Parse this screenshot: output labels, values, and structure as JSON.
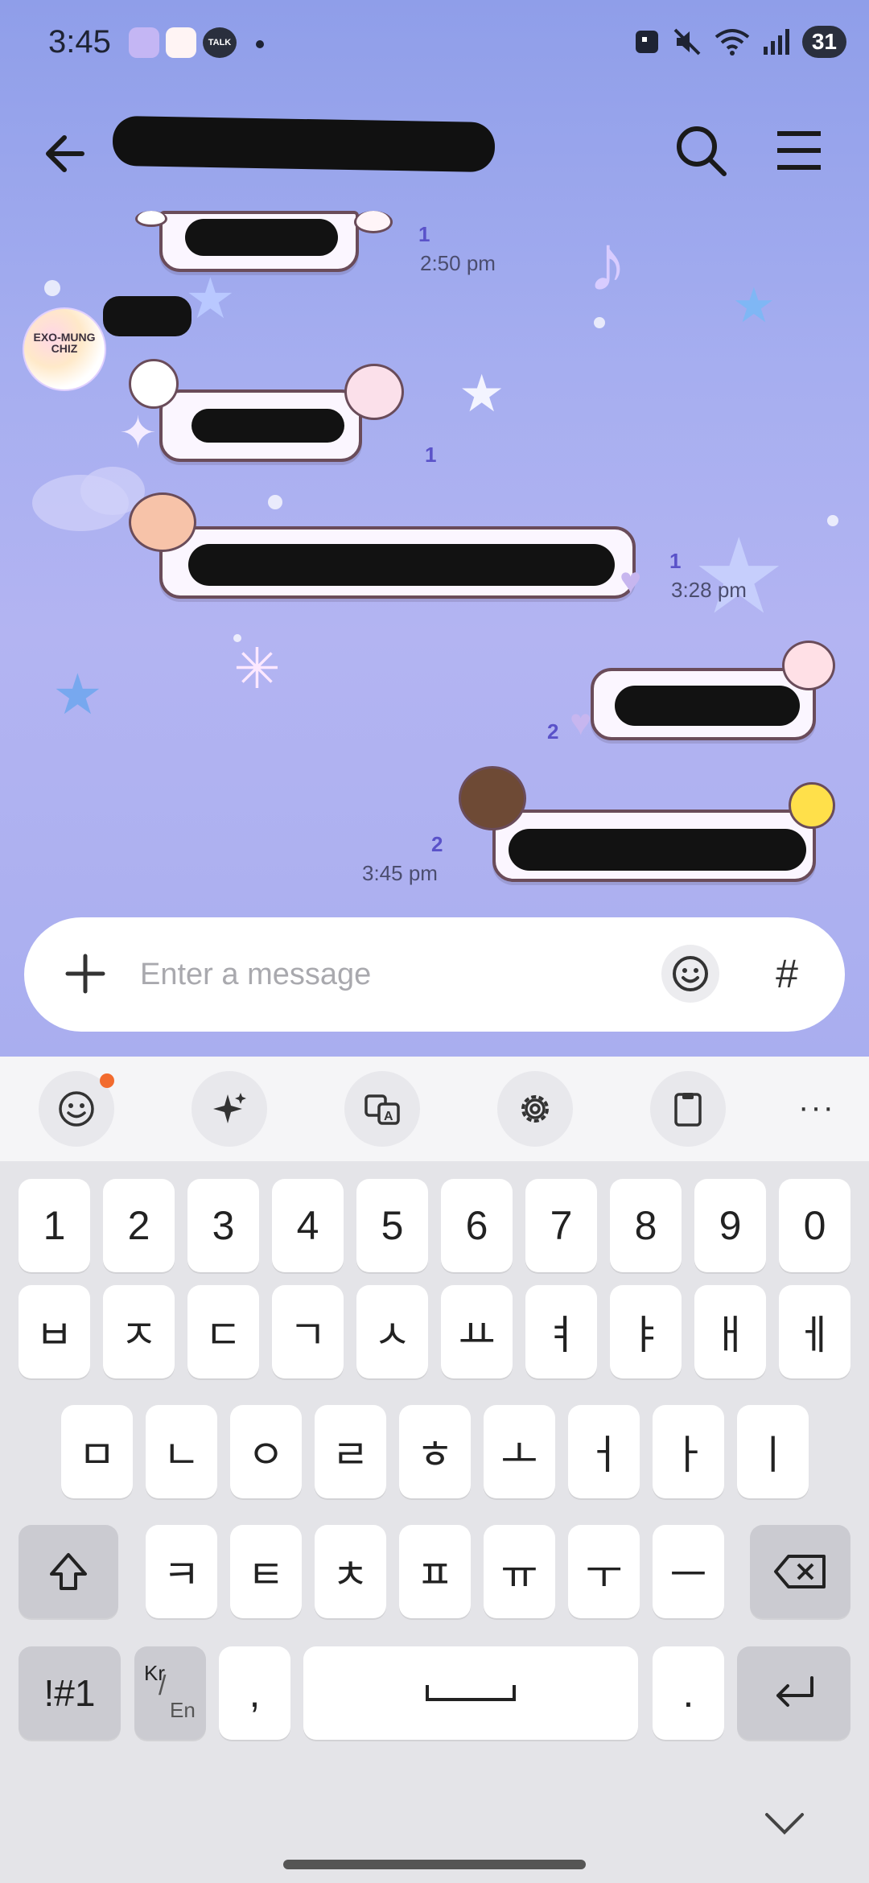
{
  "status_bar": {
    "time": "3:45",
    "app_icons": [
      "face-app-icon",
      "sticker-app-icon",
      "talk-app-icon"
    ],
    "talk_badge": "TALK",
    "battery": "31",
    "signal_icons": [
      "nfc-icon",
      "mute-icon",
      "wifi-icon",
      "cell-signal-icon"
    ]
  },
  "header": {
    "back_icon": "back-arrow-icon",
    "title_redacted": true,
    "search_icon": "search-icon",
    "menu_icon": "hamburger-menu-icon"
  },
  "avatar": {
    "label": "EXO-MUNG CHIZ"
  },
  "messages": [
    {
      "side": "left",
      "redacted": true,
      "read_count": "1",
      "time": "2:50 pm"
    },
    {
      "side": "left",
      "redacted": true,
      "read_count": "1",
      "time": ""
    },
    {
      "side": "left",
      "redacted": true,
      "read_count": "1",
      "time": "3:28 pm"
    },
    {
      "side": "right",
      "redacted": true,
      "read_count": "2",
      "time": ""
    },
    {
      "side": "right",
      "redacted": true,
      "read_count": "2",
      "time": "3:45 pm"
    }
  ],
  "input": {
    "placeholder": "Enter a message",
    "plus_icon": "plus-icon",
    "emoji_icon": "emoji-icon",
    "hash_label": "#"
  },
  "keyboard_toolbar": {
    "items": [
      "emoji-icon",
      "ai-sparkle-icon",
      "translate-icon",
      "settings-gear-icon",
      "clipboard-icon"
    ],
    "more_label": "···"
  },
  "keyboard": {
    "row1": [
      "1",
      "2",
      "3",
      "4",
      "5",
      "6",
      "7",
      "8",
      "9",
      "0"
    ],
    "row2": [
      "ㅂ",
      "ㅈ",
      "ㄷ",
      "ㄱ",
      "ㅅ",
      "ㅛ",
      "ㅕ",
      "ㅑ",
      "ㅐ",
      "ㅔ"
    ],
    "row3": [
      "ㅁ",
      "ㄴ",
      "ㅇ",
      "ㄹ",
      "ㅎ",
      "ㅗ",
      "ㅓ",
      "ㅏ",
      "ㅣ"
    ],
    "row4": [
      "ㅋ",
      "ㅌ",
      "ㅊ",
      "ㅍ",
      "ㅠ",
      "ㅜ",
      "ㅡ"
    ],
    "symbols_label": "!#1",
    "lang_top": "Kr",
    "lang_bottom": "En",
    "comma": ",",
    "period": ".",
    "shift_icon": "shift-icon",
    "backspace_icon": "backspace-icon",
    "space_icon": "space-icon",
    "enter_icon": "enter-icon",
    "hide_icon": "chevron-down-icon"
  }
}
